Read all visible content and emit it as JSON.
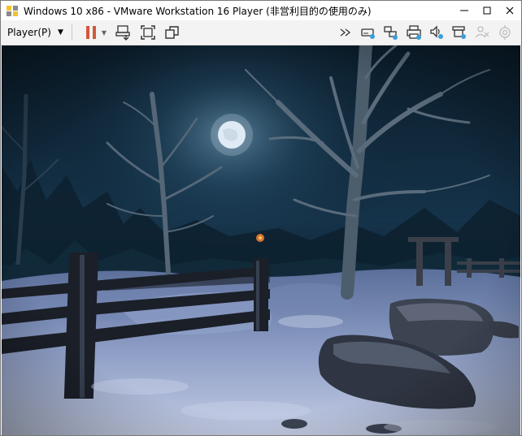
{
  "window": {
    "title": "Windows 10 x86 - VMware Workstation 16 Player (非営利目的の使用のみ)",
    "controls": [
      "minimize-icon",
      "maximize-icon",
      "close-icon"
    ]
  },
  "toolbar": {
    "player_menu_label": "Player(P)",
    "left_icons": [
      "pause-icon",
      "send-ctrl-alt-del-icon",
      "fit-guest-icon",
      "unity-icon"
    ],
    "right_icons": [
      "more-icon",
      "removable-device-icon",
      "network-adapter-icon",
      "printer-icon",
      "sound-card-icon",
      "usb-controller-icon",
      "user-disabled-icon",
      "settings-disabled-icon"
    ]
  },
  "colors": {
    "pause_accent": "#d3583b",
    "device_badge": "#3aa0d8",
    "sky_dark": "#0b1a26",
    "snow": "#b7c4dc"
  }
}
